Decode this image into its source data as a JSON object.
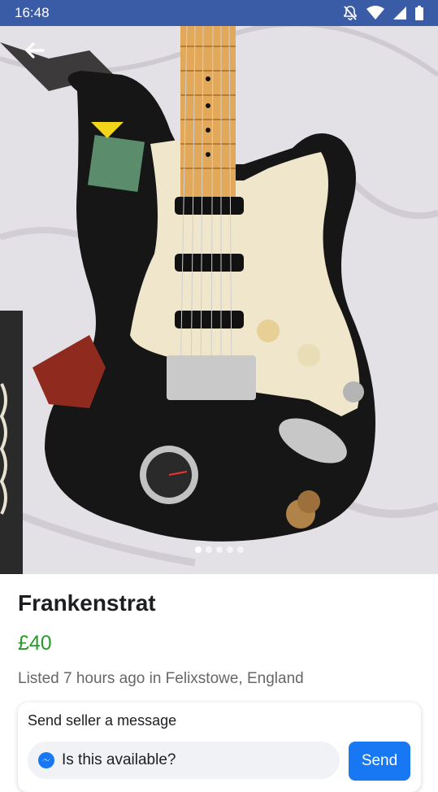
{
  "status_bar": {
    "time": "16:48",
    "icons": [
      "notifications-off-icon",
      "wifi-icon",
      "signal-icon",
      "battery-icon"
    ],
    "color": "#3a5ba6"
  },
  "listing": {
    "photo": {
      "subject": "guitar-photo",
      "page_count": 5,
      "active_page": 1
    },
    "title": "Frankenstrat",
    "price": "£40",
    "listed": "Listed 7 hours ago in Felixstowe, England"
  },
  "message": {
    "heading": "Send seller a message",
    "input_value": "Is this available?",
    "send_label": "Send",
    "accent": "#1877f2",
    "price_color": "#2a9a2a"
  }
}
